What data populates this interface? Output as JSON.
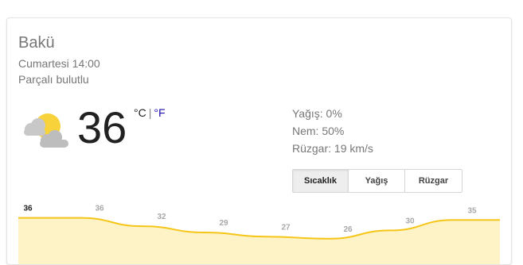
{
  "location": {
    "city": "Bakü",
    "datetime": "Cumartesi 14:00",
    "condition": "Parçalı bulutlu"
  },
  "current": {
    "icon": "partly-cloudy-icon",
    "temperature": "36",
    "unit_c": "°C",
    "unit_separator": "|",
    "unit_f": "°F"
  },
  "details": {
    "precipitation": "Yağış: 0%",
    "humidity": "Nem: 50%",
    "wind": "Rüzgar: 19 km/s"
  },
  "tabs": [
    {
      "label": "Sıcaklık",
      "active": true
    },
    {
      "label": "Yağış",
      "active": false
    },
    {
      "label": "Rüzgar",
      "active": false
    }
  ],
  "colors": {
    "line": "#f5c518",
    "fill": "#fdf3c6",
    "active_label": "#212121",
    "label": "#a8a8a8"
  },
  "chart_data": {
    "type": "area",
    "values": [
      36,
      36,
      32,
      29,
      27,
      26,
      30,
      35
    ],
    "labels": [
      "36",
      "36",
      "32",
      "29",
      "27",
      "26",
      "30",
      "35"
    ],
    "active_index": 0,
    "ylim": [
      21,
      37
    ]
  }
}
